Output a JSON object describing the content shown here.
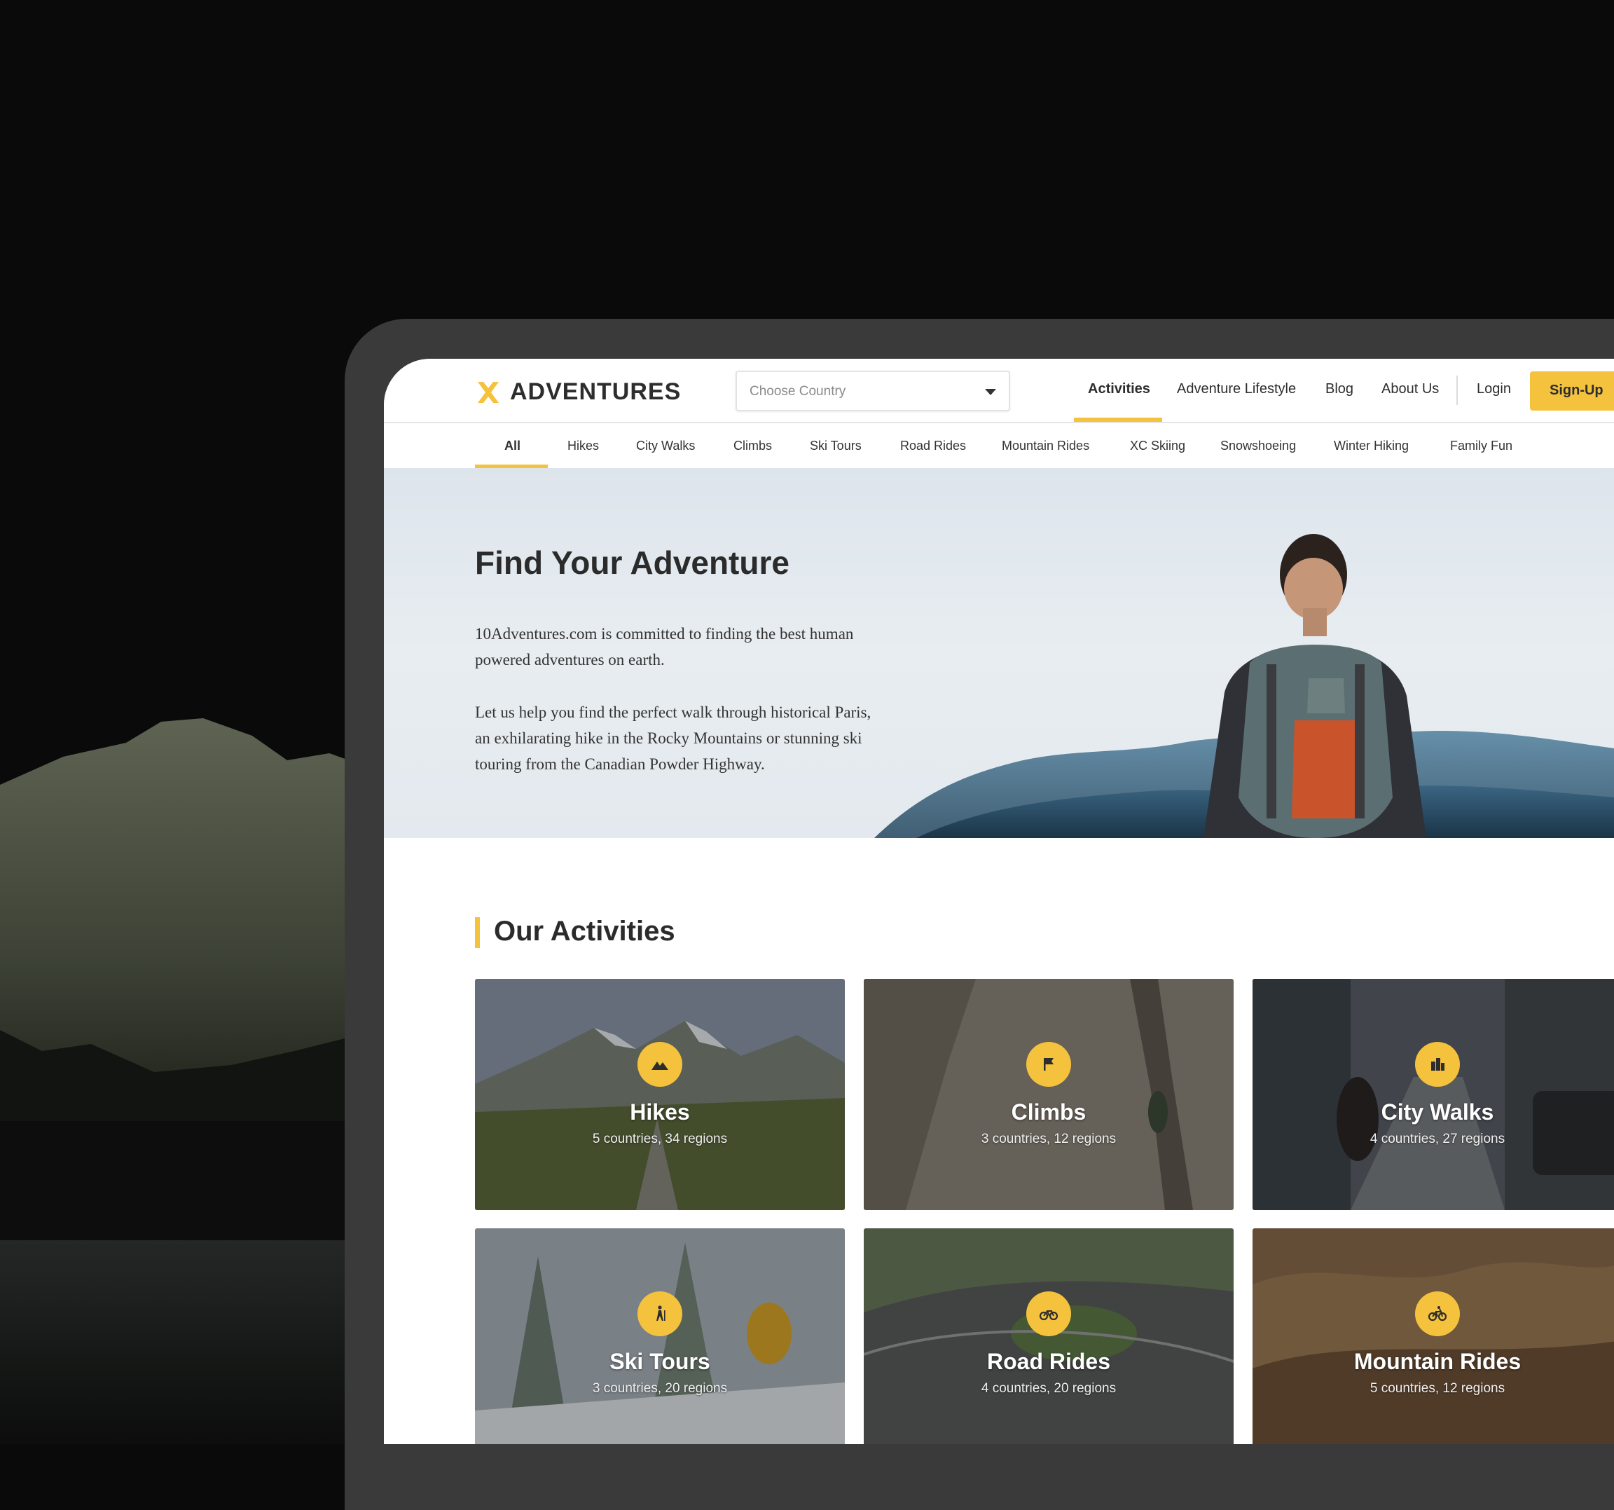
{
  "brand": {
    "name": "ADVENTURES"
  },
  "country_select": {
    "placeholder": "Choose Country"
  },
  "nav": {
    "items": [
      "Activities",
      "Adventure Lifestyle",
      "Blog",
      "About Us",
      "Login"
    ],
    "active": "Activities",
    "signup": "Sign-Up"
  },
  "tabs": {
    "items": [
      "All",
      "Hikes",
      "City Walks",
      "Climbs",
      "Ski Tours",
      "Road Rides",
      "Mountain Rides",
      "XC Skiing",
      "Snowshoeing",
      "Winter Hiking",
      "Family Fun"
    ],
    "active": "All"
  },
  "hero": {
    "title": "Find Your Adventure",
    "p1_line1": "10Adventures.com is committed to finding the best human",
    "p1_line2": "powered adventures on earth.",
    "p2_line1": "Let us help you find the perfect walk through historical Paris,",
    "p2_line2": "an exhilarating hike in the Rocky Mountains or stunning ski",
    "p2_line3": "touring from the Canadian Powder Highway."
  },
  "activities": {
    "heading": "Our Activities",
    "cards": [
      {
        "title": "Hikes",
        "subtitle": "5 countries, 34 regions",
        "icon": "mountain-icon"
      },
      {
        "title": "Climbs",
        "subtitle": "3 countries, 12 regions",
        "icon": "flag-icon"
      },
      {
        "title": "City Walks",
        "subtitle": "4 countries, 27 regions",
        "icon": "city-icon"
      },
      {
        "title": "Ski Tours",
        "subtitle": "3 countries, 20 regions",
        "icon": "hiker-icon"
      },
      {
        "title": "Road Rides",
        "subtitle": "4 countries, 20 regions",
        "icon": "road-bike-icon"
      },
      {
        "title": "Mountain Rides",
        "subtitle": "5 countries, 12 regions",
        "icon": "mountain-bike-icon"
      }
    ]
  },
  "colors": {
    "accent": "#f5c23e",
    "text": "#2d2d2d",
    "background": "#0a0a0a",
    "frame": "#3a3a3a"
  }
}
